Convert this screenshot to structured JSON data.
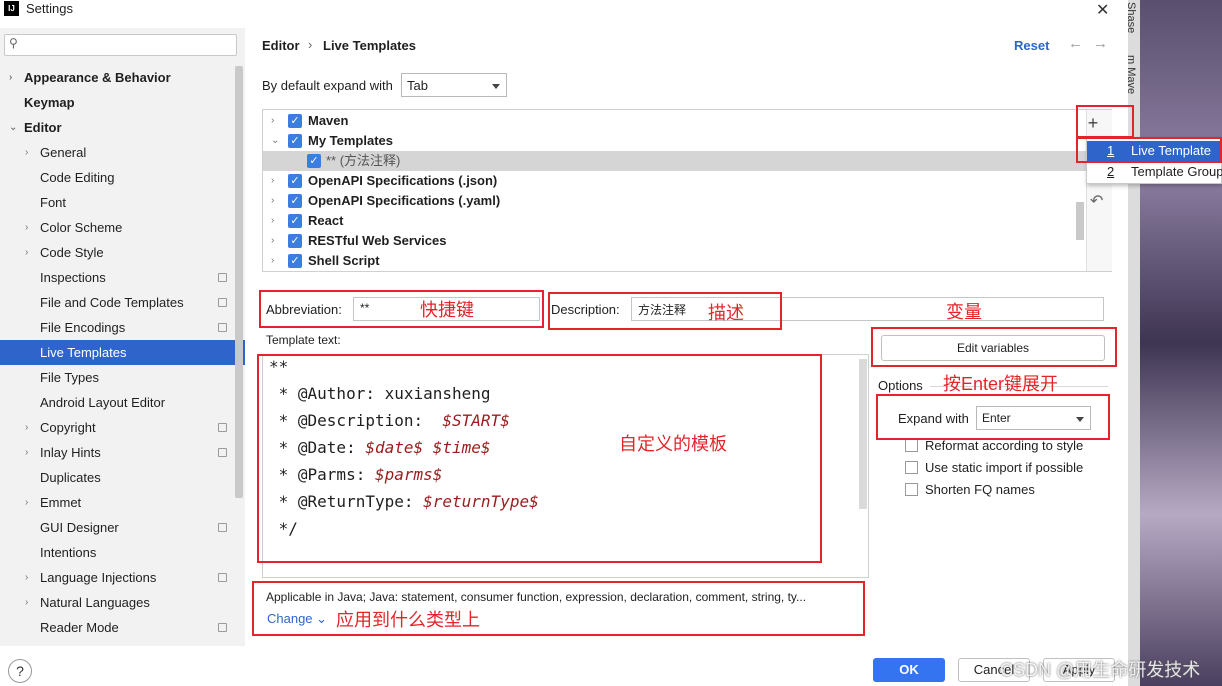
{
  "window": {
    "title": "Settings",
    "close_icon": "✕",
    "app_icon_text": "IJ"
  },
  "search": {
    "icon": "search-icon"
  },
  "sidebar": {
    "items": [
      {
        "label": "Appearance & Behavior",
        "chevron": "›",
        "bold": true
      },
      {
        "label": "Keymap",
        "bold": true
      },
      {
        "label": "Editor",
        "chevron": "⌄",
        "bold": true
      },
      {
        "label": "General",
        "chevron": "›"
      },
      {
        "label": "Code Editing"
      },
      {
        "label": "Font"
      },
      {
        "label": "Color Scheme",
        "chevron": "›"
      },
      {
        "label": "Code Style",
        "chevron": "›"
      },
      {
        "label": "Inspections",
        "page_icon": true
      },
      {
        "label": "File and Code Templates",
        "page_icon": true
      },
      {
        "label": "File Encodings",
        "page_icon": true
      },
      {
        "label": "Live Templates",
        "selected": true
      },
      {
        "label": "File Types"
      },
      {
        "label": "Android Layout Editor"
      },
      {
        "label": "Copyright",
        "chevron": "›",
        "page_icon": true
      },
      {
        "label": "Inlay Hints",
        "chevron": "›",
        "page_icon": true
      },
      {
        "label": "Duplicates"
      },
      {
        "label": "Emmet",
        "chevron": "›"
      },
      {
        "label": "GUI Designer",
        "page_icon": true
      },
      {
        "label": "Intentions"
      },
      {
        "label": "Language Injections",
        "chevron": "›",
        "page_icon": true
      },
      {
        "label": "Natural Languages",
        "chevron": "›"
      },
      {
        "label": "Reader Mode",
        "page_icon": true
      }
    ]
  },
  "breadcrumb": {
    "parent": "Editor",
    "separator": "›",
    "current": "Live Templates"
  },
  "header": {
    "reset": "Reset",
    "back_icon": "←",
    "forward_icon": "→"
  },
  "expand_default": {
    "label": "By default expand with",
    "value": "Tab"
  },
  "templates": {
    "rows": [
      {
        "name": "Maven",
        "chevron": "›",
        "indent": 0
      },
      {
        "name": "My Templates",
        "chevron": "⌄",
        "indent": 0
      },
      {
        "name": "** (方法注释)",
        "indent": 1,
        "selected": true
      },
      {
        "name": "OpenAPI Specifications (.json)",
        "chevron": "›",
        "indent": 0
      },
      {
        "name": "OpenAPI Specifications (.yaml)",
        "chevron": "›",
        "indent": 0
      },
      {
        "name": "React",
        "chevron": "›",
        "indent": 0
      },
      {
        "name": "RESTful Web Services",
        "chevron": "›",
        "indent": 0
      },
      {
        "name": "Shell Script",
        "chevron": "›",
        "indent": 0
      }
    ],
    "add_icon": "+",
    "undo_icon": "↶"
  },
  "popup": {
    "items": [
      {
        "num": "1",
        "label": "Live Template",
        "active": true
      },
      {
        "num": "2",
        "label": "Template Group"
      }
    ]
  },
  "abbreviation": {
    "label": "Abbreviation:",
    "value": "**"
  },
  "description": {
    "label": "Description:",
    "value": "方法注释"
  },
  "template_text": {
    "label": "Template text:",
    "lines": [
      [
        {
          "t": "**"
        }
      ],
      [
        {
          "t": " * @Author: xuxiansheng"
        }
      ],
      [
        {
          "t": " * @Description:  "
        },
        {
          "t": "$START$",
          "var": true
        }
      ],
      [
        {
          "t": " * @Date: "
        },
        {
          "t": "$date$",
          "var": true
        },
        {
          "t": " "
        },
        {
          "t": "$time$",
          "var": true
        }
      ],
      [
        {
          "t": " * @Parms: "
        },
        {
          "t": "$parms$",
          "var": true
        }
      ],
      [
        {
          "t": " * @ReturnType: "
        },
        {
          "t": "$returnType$",
          "var": true
        }
      ],
      [
        {
          "t": " */"
        }
      ]
    ]
  },
  "options": {
    "edit_variables": "Edit variables",
    "title": "Options",
    "expand_with_label": "Expand with",
    "expand_with_value": "Enter",
    "checks": [
      {
        "label": "Reformat according to style",
        "checked": false
      },
      {
        "label": "Use static import if possible",
        "checked": false
      },
      {
        "label": "Shorten FQ names",
        "checked": false
      }
    ]
  },
  "applicable": {
    "text": "Applicable in Java; Java: statement, consumer function, expression, declaration, comment, string, ty...",
    "change": "Change ⌄"
  },
  "buttons": {
    "ok": "OK",
    "cancel": "Cancel",
    "apply": "Apply",
    "help": "?"
  },
  "annotations": {
    "abbreviation": "快捷键",
    "description": "描述",
    "variables": "变量",
    "expand": "按Enter键展开",
    "template": "自定义的模板",
    "applicable": "应用到什么类型上"
  },
  "background": {
    "text_top": "Shase",
    "text_mid": "m Mave",
    "watermark": "CSDN @用生命研发技术"
  },
  "colors": {
    "accent": "#2f65ca",
    "annotation": "#e3252b",
    "ok": "#3574f0",
    "variable": "#9b1c1c"
  }
}
